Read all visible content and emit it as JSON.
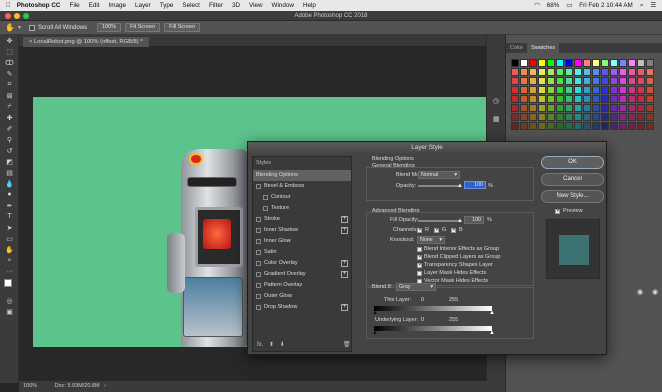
{
  "menubar": {
    "app": "Photoshop CC",
    "items": [
      "File",
      "Edit",
      "Image",
      "Layer",
      "Type",
      "Select",
      "Filter",
      "3D",
      "View",
      "Window",
      "Help"
    ],
    "battery": "68%",
    "datetime": "Fri Feb 2  10:44 AM"
  },
  "titlebar": {
    "title": "Adobe Photoshop CC 2018"
  },
  "options": {
    "scroll_all": "Scroll All Windows",
    "zoom": "100%",
    "fit_screen": "Fit Screen",
    "fill_screen": "Fill Screen"
  },
  "document": {
    "tab": "LocalRobot.png @ 100% (offset, RGB/8) *",
    "status_zoom": "100%",
    "status_doc": "Doc: 5.93M/20.8M"
  },
  "panels": {
    "tab_color": "Color",
    "tab_swatches": "Swatches"
  },
  "dialog": {
    "title": "Layer Style",
    "styles_header": "Styles",
    "styles": [
      {
        "label": "Blending Options",
        "checkbox": false,
        "plus": false,
        "selected": true
      },
      {
        "label": "Bevel & Emboss",
        "checkbox": true,
        "plus": false
      },
      {
        "label": "Contour",
        "checkbox": true,
        "plus": false,
        "indent": true
      },
      {
        "label": "Texture",
        "checkbox": true,
        "plus": false,
        "indent": true
      },
      {
        "label": "Stroke",
        "checkbox": true,
        "plus": true
      },
      {
        "label": "Inner Shadow",
        "checkbox": true,
        "plus": true
      },
      {
        "label": "Inner Glow",
        "checkbox": true,
        "plus": false
      },
      {
        "label": "Satin",
        "checkbox": true,
        "plus": false
      },
      {
        "label": "Color Overlay",
        "checkbox": true,
        "plus": true
      },
      {
        "label": "Gradient Overlay",
        "checkbox": true,
        "plus": true
      },
      {
        "label": "Pattern Overlay",
        "checkbox": true,
        "plus": false
      },
      {
        "label": "Outer Glow",
        "checkbox": true,
        "plus": false
      },
      {
        "label": "Drop Shadow",
        "checkbox": true,
        "plus": true
      }
    ],
    "fx_label": "fx.",
    "blending_options": "Blending Options",
    "general_blending": "General Blending",
    "blend_mode_label": "Blend Mode:",
    "blend_mode_value": "Normal",
    "opacity_label": "Opacity:",
    "opacity_value": "100",
    "percent": "%",
    "advanced_blending": "Advanced Blending",
    "fill_opacity_label": "Fill Opacity:",
    "fill_opacity_value": "100",
    "channels_label": "Channels:",
    "channel_r": "R",
    "channel_g": "G",
    "channel_b": "B",
    "knockout_label": "Knockout:",
    "knockout_value": "None",
    "check_interior": "Blend Interior Effects as Group",
    "check_clipped": "Blend Clipped Layers as Group",
    "check_transparency": "Transparency Shapes Layer",
    "check_layer_mask": "Layer Mask Hides Effects",
    "check_vector_mask": "Vector Mask Hides Effects",
    "blend_if_label": "Blend If:",
    "blend_if_value": "Gray",
    "this_layer_label": "This Layer:",
    "this_layer_min": "0",
    "this_layer_max": "255",
    "underlying_label": "Underlying Layer:",
    "underlying_min": "0",
    "underlying_max": "255",
    "ok": "OK",
    "cancel": "Cancel",
    "new_style": "New Style...",
    "preview_label": "Preview"
  },
  "colors": {
    "canvas": "#5bc38b",
    "ui_dark": "#262626",
    "panel": "#535353",
    "preview_swatch": "#3d7273"
  }
}
